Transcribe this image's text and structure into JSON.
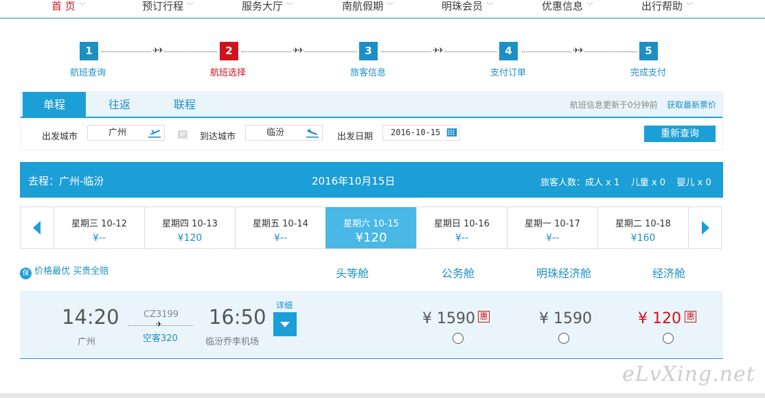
{
  "nav": {
    "items": [
      {
        "label": "首 页",
        "active": true
      },
      {
        "label": "预订行程",
        "active": false
      },
      {
        "label": "服务大厅",
        "active": false
      },
      {
        "label": "南航假期",
        "active": false
      },
      {
        "label": "明珠会员",
        "active": false
      },
      {
        "label": "优惠信息",
        "active": false
      },
      {
        "label": "出行帮助",
        "active": false
      }
    ],
    "caret": "﹀"
  },
  "steps": [
    {
      "num": "1",
      "label": "航班查询",
      "active": false
    },
    {
      "num": "2",
      "label": "航班选择",
      "active": true
    },
    {
      "num": "3",
      "label": "旅客信息",
      "active": false
    },
    {
      "num": "4",
      "label": "支付订单",
      "active": false
    },
    {
      "num": "5",
      "label": "完成支付",
      "active": false
    }
  ],
  "step_plane": "✈✈",
  "search": {
    "tabs": [
      "单程",
      "往返",
      "联程"
    ],
    "active_tab": 0,
    "update_info": "航班信息更新于0分钟前",
    "refresh_link": "获取最新票价",
    "depart_label": "出发城市",
    "depart_value": "广州",
    "arrive_label": "到达城市",
    "arrive_value": "临汾",
    "date_label": "出发日期",
    "date_value": "2016-10-15",
    "swap_icon": "⇄",
    "requery_label": "重新查询"
  },
  "route": {
    "title": "去程：广州-临汾",
    "date": "2016年10月15日",
    "passengers": "旅客人数：成人 x 1    儿童 x 0    婴儿 x 0"
  },
  "dates": [
    {
      "day": "星期三  10-12",
      "price": "¥--"
    },
    {
      "day": "星期四  10-13",
      "price": "¥120"
    },
    {
      "day": "星期五  10-14",
      "price": "¥--"
    },
    {
      "day": "星期六  10-15",
      "price": "¥120",
      "selected": true
    },
    {
      "day": "星期日  10-16",
      "price": "¥--"
    },
    {
      "day": "星期一  10-17",
      "price": "¥--"
    },
    {
      "day": "星期二  10-18",
      "price": "¥160"
    }
  ],
  "guarantee": {
    "icon": "保",
    "text": "价格最优 买贵全赔"
  },
  "cabins": [
    "头等舱",
    "公务舱",
    "明珠经济舱",
    "经济舱"
  ],
  "flight": {
    "dep_time": "14:20",
    "dep_city": "广州",
    "flight_no": "CZ3199",
    "plane_glyph": "✈",
    "aircraft": "空客320",
    "arr_time": "16:50",
    "arr_airport": "临汾乔李机场",
    "detail_label": "详细",
    "prices": [
      {
        "cabin": "公务舱",
        "price": "¥ 1590",
        "badge": "惠"
      },
      {
        "cabin": "明珠经济舱",
        "price": "¥ 1590",
        "badge": ""
      },
      {
        "cabin": "经济舱",
        "price": "¥ 120",
        "badge": "惠"
      }
    ]
  },
  "watermark": "eLvXing.net",
  "colors": {
    "accent": "#1c9ed6",
    "link": "#1c8fc5",
    "active_red": "#d0121c",
    "selected_date": "#49b8e6",
    "row_bg": "#eaf5fb"
  }
}
